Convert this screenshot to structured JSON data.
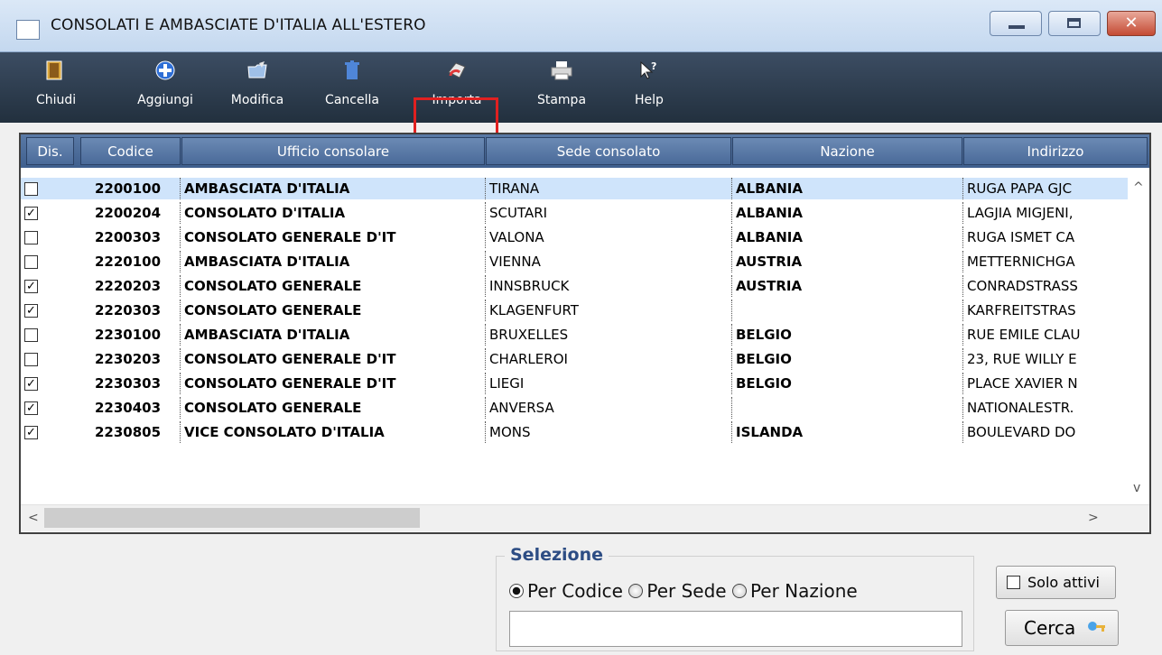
{
  "window": {
    "title": "CONSOLATI E AMBASCIATE D'ITALIA ALL'ESTERO",
    "close_glyph": "✕"
  },
  "toolbar": {
    "chiudi": "Chiudi",
    "aggiungi": "Aggiungi",
    "modifica": "Modifica",
    "cancella": "Cancella",
    "importa": "Importa",
    "stampa": "Stampa",
    "help": "Help"
  },
  "table": {
    "columns": [
      "Dis.",
      "Codice",
      "Ufficio consolare",
      "Sede consolato",
      "Nazione",
      "Indirizzo"
    ],
    "rows": [
      {
        "checked": false,
        "codice": "2200100",
        "ufficio": "AMBASCIATA D'ITALIA",
        "sede": "TIRANA",
        "nazione": "ALBANIA",
        "indirizzo": "RUGA PAPA GJC"
      },
      {
        "checked": true,
        "codice": "2200204",
        "ufficio": "CONSOLATO D'ITALIA",
        "sede": "SCUTARI",
        "nazione": "ALBANIA",
        "indirizzo": "LAGJIA MIGJENI,"
      },
      {
        "checked": false,
        "codice": "2200303",
        "ufficio": "CONSOLATO GENERALE D'IT",
        "sede": "VALONA",
        "nazione": "ALBANIA",
        "indirizzo": "RUGA ISMET CA"
      },
      {
        "checked": false,
        "codice": "2220100",
        "ufficio": "AMBASCIATA D'ITALIA",
        "sede": "VIENNA",
        "nazione": "AUSTRIA",
        "indirizzo": "METTERNICHGA"
      },
      {
        "checked": true,
        "codice": "2220203",
        "ufficio": "CONSOLATO GENERALE",
        "sede": "INNSBRUCK",
        "nazione": "AUSTRIA",
        "indirizzo": "CONRADSTRASS"
      },
      {
        "checked": true,
        "codice": "2220303",
        "ufficio": "CONSOLATO GENERALE",
        "sede": "KLAGENFURT",
        "nazione": "",
        "indirizzo": "KARFREITSTRAS"
      },
      {
        "checked": false,
        "codice": "2230100",
        "ufficio": "AMBASCIATA D'ITALIA",
        "sede": "BRUXELLES",
        "nazione": "BELGIO",
        "indirizzo": "RUE EMILE CLAU"
      },
      {
        "checked": false,
        "codice": "2230203",
        "ufficio": "CONSOLATO GENERALE D'IT",
        "sede": "CHARLEROI",
        "nazione": "BELGIO",
        "indirizzo": "23, RUE WILLY E"
      },
      {
        "checked": true,
        "codice": "2230303",
        "ufficio": "CONSOLATO GENERALE D'IT",
        "sede": "LIEGI",
        "nazione": "BELGIO",
        "indirizzo": "PLACE XAVIER N"
      },
      {
        "checked": true,
        "codice": "2230403",
        "ufficio": "CONSOLATO GENERALE",
        "sede": "ANVERSA",
        "nazione": "",
        "indirizzo": "NATIONALESTR."
      },
      {
        "checked": true,
        "codice": "2230805",
        "ufficio": "VICE CONSOLATO D'ITALIA",
        "sede": "MONS",
        "nazione": "ISLANDA",
        "indirizzo": "BOULEVARD DO"
      }
    ],
    "scroll_up": "^",
    "scroll_down": "v",
    "scroll_left": "<",
    "scroll_right": ">"
  },
  "selezione": {
    "title": "Selezione",
    "per_codice": "Per Codice",
    "per_sede": "Per Sede",
    "per_nazione": "Per Nazione",
    "selected": "per_codice",
    "search_value": "",
    "solo_attivi": "Solo attivi",
    "solo_attivi_checked": false,
    "cerca": "Cerca"
  },
  "colors": {
    "header_blue": "#4a6a99",
    "title_accent": "#2d4d84",
    "highlight": "#e02020",
    "selected_row": "#cfe4fb"
  }
}
